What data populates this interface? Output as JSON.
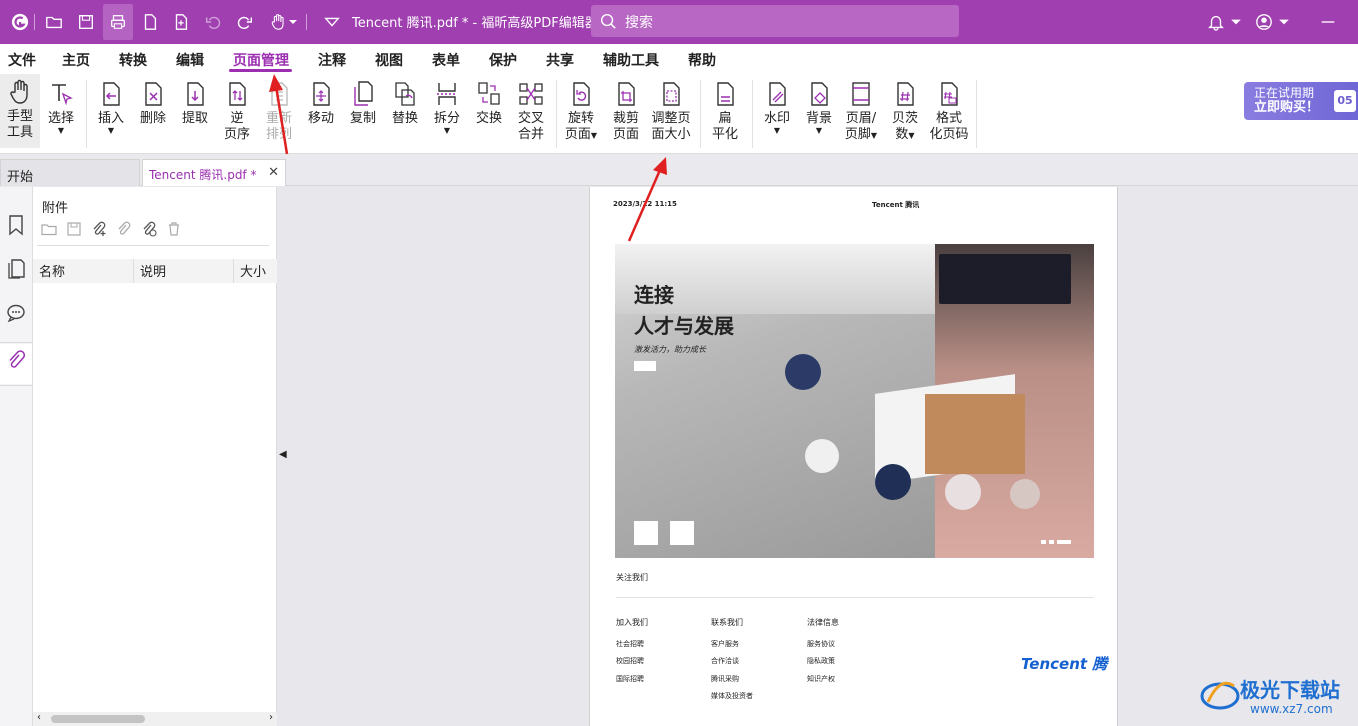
{
  "titlebar": {
    "doc_title": "Tencent 腾讯.pdf * - 福昕高级PDF编辑器",
    "search_placeholder": "搜索"
  },
  "menu": [
    "文件",
    "主页",
    "转换",
    "编辑",
    "页面管理",
    "注释",
    "视图",
    "表单",
    "保护",
    "共享",
    "辅助工具",
    "帮助"
  ],
  "menu_active": "页面管理",
  "ribbon": {
    "hand": [
      "手型",
      "工具"
    ],
    "select": "选择",
    "insert": "插入",
    "delete": "删除",
    "extract": "提取",
    "reverse": [
      "逆",
      "页序"
    ],
    "reorder": [
      "重新",
      "排列"
    ],
    "move": "移动",
    "copy": "复制",
    "replace": "替换",
    "split": "拆分",
    "swap": "交换",
    "cross_merge": [
      "交叉",
      "合并"
    ],
    "rotate": [
      "旋转",
      "页面"
    ],
    "crop": [
      "裁剪",
      "页面"
    ],
    "resize": [
      "调整页",
      "面大小"
    ],
    "flatten": [
      "扁",
      "平化"
    ],
    "watermark": "水印",
    "background": "背景",
    "header_footer": [
      "页眉/",
      "页脚"
    ],
    "bates": [
      "贝茨",
      "数"
    ],
    "format_page_number": [
      "格式",
      "化页码"
    ]
  },
  "trial": {
    "line1": "正在试用期",
    "line2": "立即购买！",
    "badge": "05"
  },
  "tabs": {
    "home": "开始",
    "doc": "Tencent 腾讯.pdf *"
  },
  "panel": {
    "title": "附件",
    "columns": [
      "名称",
      "说明",
      "大小"
    ]
  },
  "page": {
    "date": "2023/3/22 11:15",
    "brand": "Tencent 腾讯",
    "hero_title1": "连接",
    "hero_title2": "人才与发展",
    "hero_sub": "激发活力，助力成长",
    "follow": "关注我们",
    "footer": [
      {
        "head": "加入我们",
        "items": [
          "社会招聘",
          "校园招聘",
          "国际招聘"
        ]
      },
      {
        "head": "联系我们",
        "items": [
          "客户服务",
          "合作洽谈",
          "腾讯采购",
          "媒体及投资者"
        ]
      },
      {
        "head": "法律信息",
        "items": [
          "服务协议",
          "隐私政策",
          "知识产权"
        ]
      }
    ],
    "logo": "Tencent 腾"
  },
  "watermark": {
    "title": "极光下载站",
    "url": "www.xz7.com"
  },
  "colors": {
    "brand": "#a03fb0",
    "accent": "#9b2fb0",
    "arrow": "#e02020"
  }
}
